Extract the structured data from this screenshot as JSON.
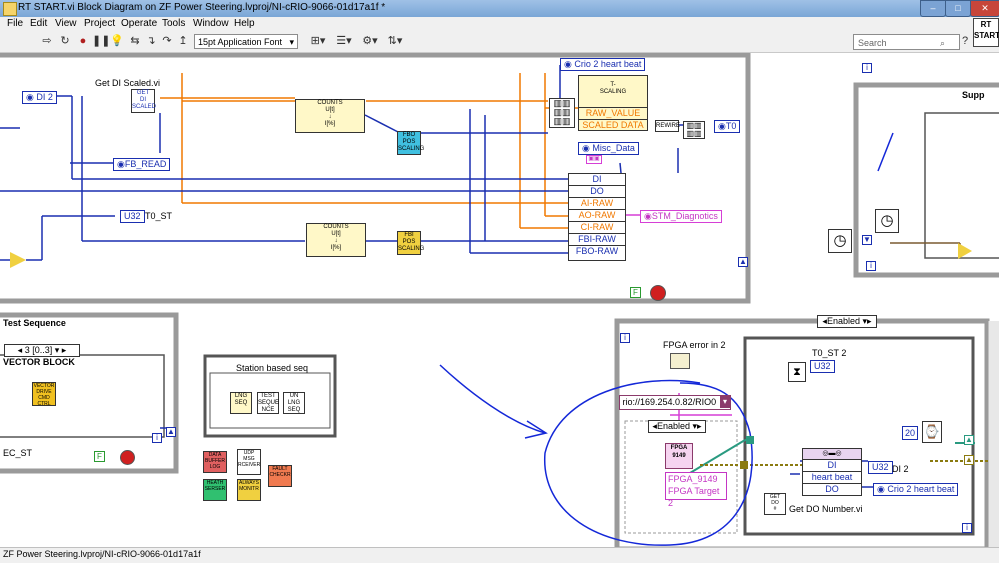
{
  "window": {
    "title": "RT START.vi Block Diagram on ZF Power Steering.lvproj/NI-cRIO-9066-01d17a1f *",
    "controls": [
      "–",
      "□",
      "✕"
    ]
  },
  "menubar": [
    "File",
    "Edit",
    "View",
    "Project",
    "Operate",
    "Tools",
    "Window",
    "Help"
  ],
  "toolbar": {
    "font": "15pt Application Font",
    "search_placeholder": "Search",
    "rt_badge": "RT\nSTART"
  },
  "diagram": {
    "top_frame": {
      "get_di_label": "Get DI Scaled.vi",
      "get_di_icon": "GET\nDI\nSCALED",
      "di2_terminal": "DI 2",
      "fb_read": "FB_READ",
      "t0_st_type": "U32",
      "t0_st": "T0_ST",
      "counts_top": "COUNTS\nU[t]\n↓\nI[%]",
      "counts_bottom": "COUNTS\nU[t]\n↓\nI[%]",
      "fbo_pos": "FBO\nPOS\nSCALING",
      "fbi_pos": "FBI\nPOS\nSCALING",
      "crio2_heartbeat": "Crio 2 heart beat",
      "t_scaling": "T-\nSCALING",
      "raw_value": "RAW_VALUE",
      "scaled_data": "SCALED DATA",
      "rewire": "REWIRE",
      "t0_out": "T0",
      "misc_data": "Misc_Data",
      "bundle_items": [
        "DI",
        "DO",
        "AI-RAW",
        "AO-RAW",
        "CI-RAW",
        "FBI-RAW",
        "FBO-RAW"
      ],
      "stm_diag": "STM_Diagnotics",
      "bool_f": "F",
      "supp_label": "Supp"
    },
    "test_sequence": {
      "title": "Test Sequence",
      "case_selector": "3 [0..3]",
      "vector_block": "VECTOR BLOCK",
      "vector_icon": "VECTOR\nDRIVE\nCMD\nCTRL",
      "ec_st": "EC_ST",
      "bool_f": "F"
    },
    "station_seq": {
      "title": "Station based seq",
      "icons": [
        "LNG\nSEQ",
        "TEST\nSEQUE\nNCE",
        "UN LNG\nSEQ"
      ]
    },
    "loose_vis": [
      {
        "text": "DATA\nBUFFER\nLOG",
        "color": "#e06060"
      },
      {
        "text": "UDP\nMSG\nRCEIVER",
        "color": "#ffffff"
      },
      {
        "text": "FAULT\nCHECKR",
        "color": "#f07a50"
      },
      {
        "text": "HEATH\nSERSER",
        "color": "#30c070"
      },
      {
        "text": "ALWAYS\nMONITR",
        "color": "#f0d040"
      }
    ],
    "fpga_frame": {
      "case_top": "Enabled",
      "fpga_error_in": "FPGA error in  2",
      "rio_address": "rio://169.254.0.82/RIO0",
      "case_inner": "Enabled",
      "fpga_icon": "FPGA\n9149",
      "fpga_label_1": "FPGA_9149",
      "fpga_label_2": "FPGA Target 2",
      "t0_st2": "T0_ST 2",
      "u32": "U32",
      "const_20": "20",
      "di_out": "DI",
      "heart_beat": "heart beat",
      "do_out": "DO",
      "di2_out": "DI 2",
      "crio2_hb_out": "Crio 2 heart beat",
      "get_do_icon": "GET\nDO\n#",
      "get_do_label": "Get DO Number.vi"
    }
  },
  "statusbar": {
    "text": "ZF Power Steering.lvproj/NI-cRIO-9066-01d17a1f"
  },
  "colors": {
    "wire_orange": "#f07800",
    "wire_blue": "#1a2fb0",
    "wire_pink": "#d63fd6",
    "frame_gray": "#9a9a9a",
    "annotation_blue": "#1428d8"
  }
}
